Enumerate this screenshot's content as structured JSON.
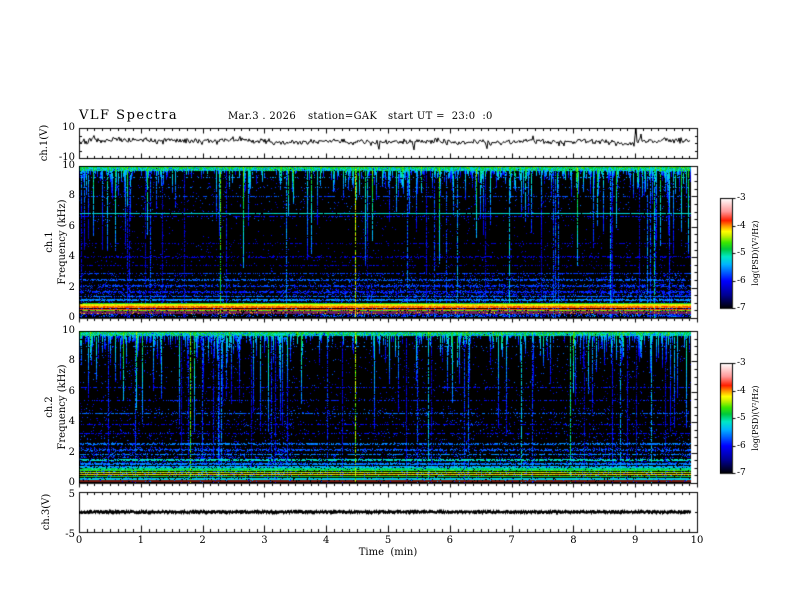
{
  "header": {
    "title": "VLF Spectra",
    "date": "Mar.3 . 2026",
    "station": "station=GAK",
    "start_ut": "start UT =  23:0  :0"
  },
  "x_axis": {
    "label": "Time  (min)",
    "ticks": [
      0,
      1,
      2,
      3,
      4,
      5,
      6,
      7,
      8,
      9,
      10
    ],
    "range": [
      0,
      10
    ],
    "minor_divisions": 8
  },
  "colorbar": {
    "label": "log(PSD)(V²/Hz)",
    "ticks": [
      -3,
      -4,
      -5,
      -6,
      -7
    ],
    "range": [
      -7,
      -3
    ],
    "stops": [
      [
        0,
        "#000000"
      ],
      [
        0.12,
        "#000090"
      ],
      [
        0.25,
        "#0000ff"
      ],
      [
        0.4,
        "#00b4ff"
      ],
      [
        0.47,
        "#00e8c8"
      ],
      [
        0.54,
        "#00c83c"
      ],
      [
        0.6,
        "#3ce800"
      ],
      [
        0.66,
        "#c8f000"
      ],
      [
        0.7,
        "#ffff00"
      ],
      [
        0.75,
        "#ff9600"
      ],
      [
        0.8,
        "#ff1e00"
      ],
      [
        0.88,
        "#ff9696"
      ],
      [
        1,
        "#ffffff"
      ]
    ]
  },
  "chart_data": [
    {
      "type": "line",
      "panel": "ch1-waveform",
      "ylabel": "ch.1(V)",
      "ylim": [
        -10,
        10
      ],
      "yticks": [
        10,
        -10
      ],
      "time_end_min": 9.9,
      "mean": 1.2,
      "noise_std": 1.8,
      "spikes": [
        [
          9.02,
          9.8
        ],
        [
          9.1,
          6.0
        ],
        [
          0.25,
          5.0
        ],
        [
          4.85,
          -4.2
        ],
        [
          5.42,
          -4.6
        ],
        [
          7.35,
          4.8
        ],
        [
          2.6,
          4.4
        ],
        [
          6.6,
          -3.8
        ]
      ],
      "seed": 7
    },
    {
      "type": "spectrogram",
      "panel": "ch1-spectrogram",
      "ylabel_line1": "ch.1",
      "ylabel_line2": "Frequency (kHz)",
      "ylim": [
        0,
        10
      ],
      "yticks": [
        0,
        2,
        4,
        6,
        8,
        10
      ],
      "value_range": [
        -7,
        -3
      ],
      "time_end_min": 9.9,
      "seed": 101,
      "noise_regions": [
        [
          6.4,
          9.6,
          0.035,
          -6.5,
          -5.6
        ],
        [
          5.0,
          6.4,
          0.012,
          -6.5,
          -5.9
        ],
        [
          3.0,
          5.0,
          0.018,
          -6.5,
          -5.8
        ],
        [
          2.3,
          3.0,
          0.08,
          -6.4,
          -5.6
        ],
        [
          1.05,
          2.3,
          0.24,
          -6.4,
          -5.6
        ],
        [
          0.32,
          1.05,
          0.18,
          -6.3,
          -5.5
        ],
        [
          0.07,
          0.32,
          0.5,
          -6.3,
          -5.4
        ]
      ],
      "hlines": [
        [
          9.3,
          0.04,
          -5.5,
          0.22
        ],
        [
          8.6,
          0.04,
          -5.65,
          0.18
        ],
        [
          8.05,
          0.04,
          -5.75,
          0.4
        ],
        [
          6.9,
          0.05,
          -5.2,
          0.97
        ],
        [
          6.72,
          0.04,
          -6.0,
          0.45
        ],
        [
          4.95,
          0.04,
          -6.2,
          0.35
        ],
        [
          4.05,
          0.04,
          -6.15,
          0.4
        ],
        [
          3.5,
          0.04,
          -6.2,
          0.35
        ],
        [
          2.95,
          0.05,
          -5.8,
          0.6
        ],
        [
          2.55,
          0.05,
          -5.7,
          0.6
        ],
        [
          2.15,
          0.05,
          -5.8,
          0.55
        ],
        [
          1.75,
          0.06,
          -5.9,
          0.7
        ],
        [
          1.45,
          0.06,
          -5.65,
          0.75
        ],
        [
          1.2,
          0.06,
          -5.55,
          0.8
        ],
        [
          1.0,
          0.045,
          -4.75,
          1.0
        ],
        [
          0.88,
          0.05,
          -4.2,
          1.0
        ],
        [
          0.74,
          0.07,
          -3.95,
          1.0
        ],
        [
          0.6,
          0.05,
          -3.8,
          1.0
        ],
        [
          0.52,
          0.03,
          -4.55,
          0.8
        ],
        [
          0.38,
          0.07,
          -4.05,
          0.1
        ]
      ],
      "color_bands": [
        [
          0.28,
          0.48,
          "#6e1f5a",
          0.88
        ]
      ],
      "vlines": [
        [
          2.28,
          -4.7
        ],
        [
          4.47,
          -4.35
        ],
        [
          1.15,
          -5.8
        ],
        [
          3.35,
          -5.6
        ],
        [
          5.3,
          -5.7
        ],
        [
          6.12,
          -5.5
        ],
        [
          6.95,
          -5.35
        ],
        [
          7.7,
          -5.8
        ],
        [
          8.6,
          -5.45
        ],
        [
          9.3,
          -5.1
        ]
      ],
      "n_random_vlines": 22,
      "sferics": {
        "p_streak": 0.78,
        "v_top": [
          -5.4,
          -4.6
        ],
        "length_dist": [
          0.62,
          0.87
        ]
      }
    },
    {
      "type": "spectrogram",
      "panel": "ch2-spectrogram",
      "ylabel_line1": "ch.2",
      "ylabel_line2": "Frequency (kHz)",
      "ylim": [
        0,
        10
      ],
      "yticks": [
        0,
        2,
        4,
        6,
        8,
        10
      ],
      "value_range": [
        -7,
        -3
      ],
      "time_end_min": 9.9,
      "seed": 202,
      "noise_regions": [
        [
          6.4,
          9.6,
          0.03,
          -6.5,
          -5.6
        ],
        [
          5.0,
          6.4,
          0.022,
          -6.5,
          -5.8
        ],
        [
          3.4,
          5.0,
          0.06,
          -6.4,
          -5.6
        ],
        [
          2.4,
          3.4,
          0.07,
          -6.4,
          -5.6
        ],
        [
          1.05,
          2.4,
          0.22,
          -6.4,
          -5.6
        ],
        [
          0.32,
          1.05,
          0.2,
          -6.3,
          -5.5
        ],
        [
          0.07,
          0.32,
          0.45,
          -6.3,
          -5.4
        ]
      ],
      "hlines": [
        [
          9.0,
          0.04,
          -5.6,
          0.2
        ],
        [
          6.3,
          0.04,
          -5.95,
          0.45
        ],
        [
          5.45,
          0.04,
          -5.9,
          0.45
        ],
        [
          4.6,
          0.05,
          -5.65,
          0.55
        ],
        [
          3.9,
          0.04,
          -6.05,
          0.45
        ],
        [
          3.3,
          0.04,
          -6.0,
          0.45
        ],
        [
          2.6,
          0.05,
          -5.6,
          0.6
        ],
        [
          2.2,
          0.05,
          -5.7,
          0.55
        ],
        [
          1.9,
          0.05,
          -5.5,
          0.65
        ],
        [
          1.55,
          0.05,
          -5.15,
          0.75
        ],
        [
          1.3,
          0.06,
          -5.55,
          0.8
        ],
        [
          1.1,
          0.06,
          -5.4,
          0.8
        ],
        [
          0.95,
          0.04,
          -4.95,
          0.95
        ],
        [
          0.85,
          0.04,
          -4.65,
          0.97
        ],
        [
          0.72,
          0.05,
          -4.4,
          1.0
        ],
        [
          0.6,
          0.05,
          -4.15,
          1.0
        ],
        [
          0.45,
          0.04,
          -4.75,
          0.97
        ],
        [
          0.3,
          0.04,
          -5.25,
          0.9
        ]
      ],
      "color_bands": [
        [
          0.12,
          0.22,
          "#7a1a10",
          0.9
        ]
      ],
      "vlines": [
        [
          1.8,
          -4.65
        ],
        [
          4.47,
          -4.45
        ],
        [
          0.9,
          -5.8
        ],
        [
          2.3,
          -5.6
        ],
        [
          3.1,
          -5.9
        ],
        [
          5.65,
          -5.35
        ],
        [
          6.3,
          -5.7
        ],
        [
          7.15,
          -5.25
        ],
        [
          7.95,
          -4.95
        ],
        [
          8.75,
          -5.5
        ],
        [
          9.25,
          -5.4
        ]
      ],
      "n_random_vlines": 22,
      "sferics": {
        "p_streak": 0.7,
        "v_top": [
          -5.4,
          -4.7
        ],
        "length_dist": [
          0.62,
          0.87
        ]
      }
    },
    {
      "type": "line",
      "panel": "ch3-waveform",
      "ylabel": "ch.3(V)",
      "ylim": [
        -5,
        5
      ],
      "yticks": [
        5,
        -5
      ],
      "time_end_min": 9.9,
      "value": 0,
      "seed": 9
    }
  ]
}
